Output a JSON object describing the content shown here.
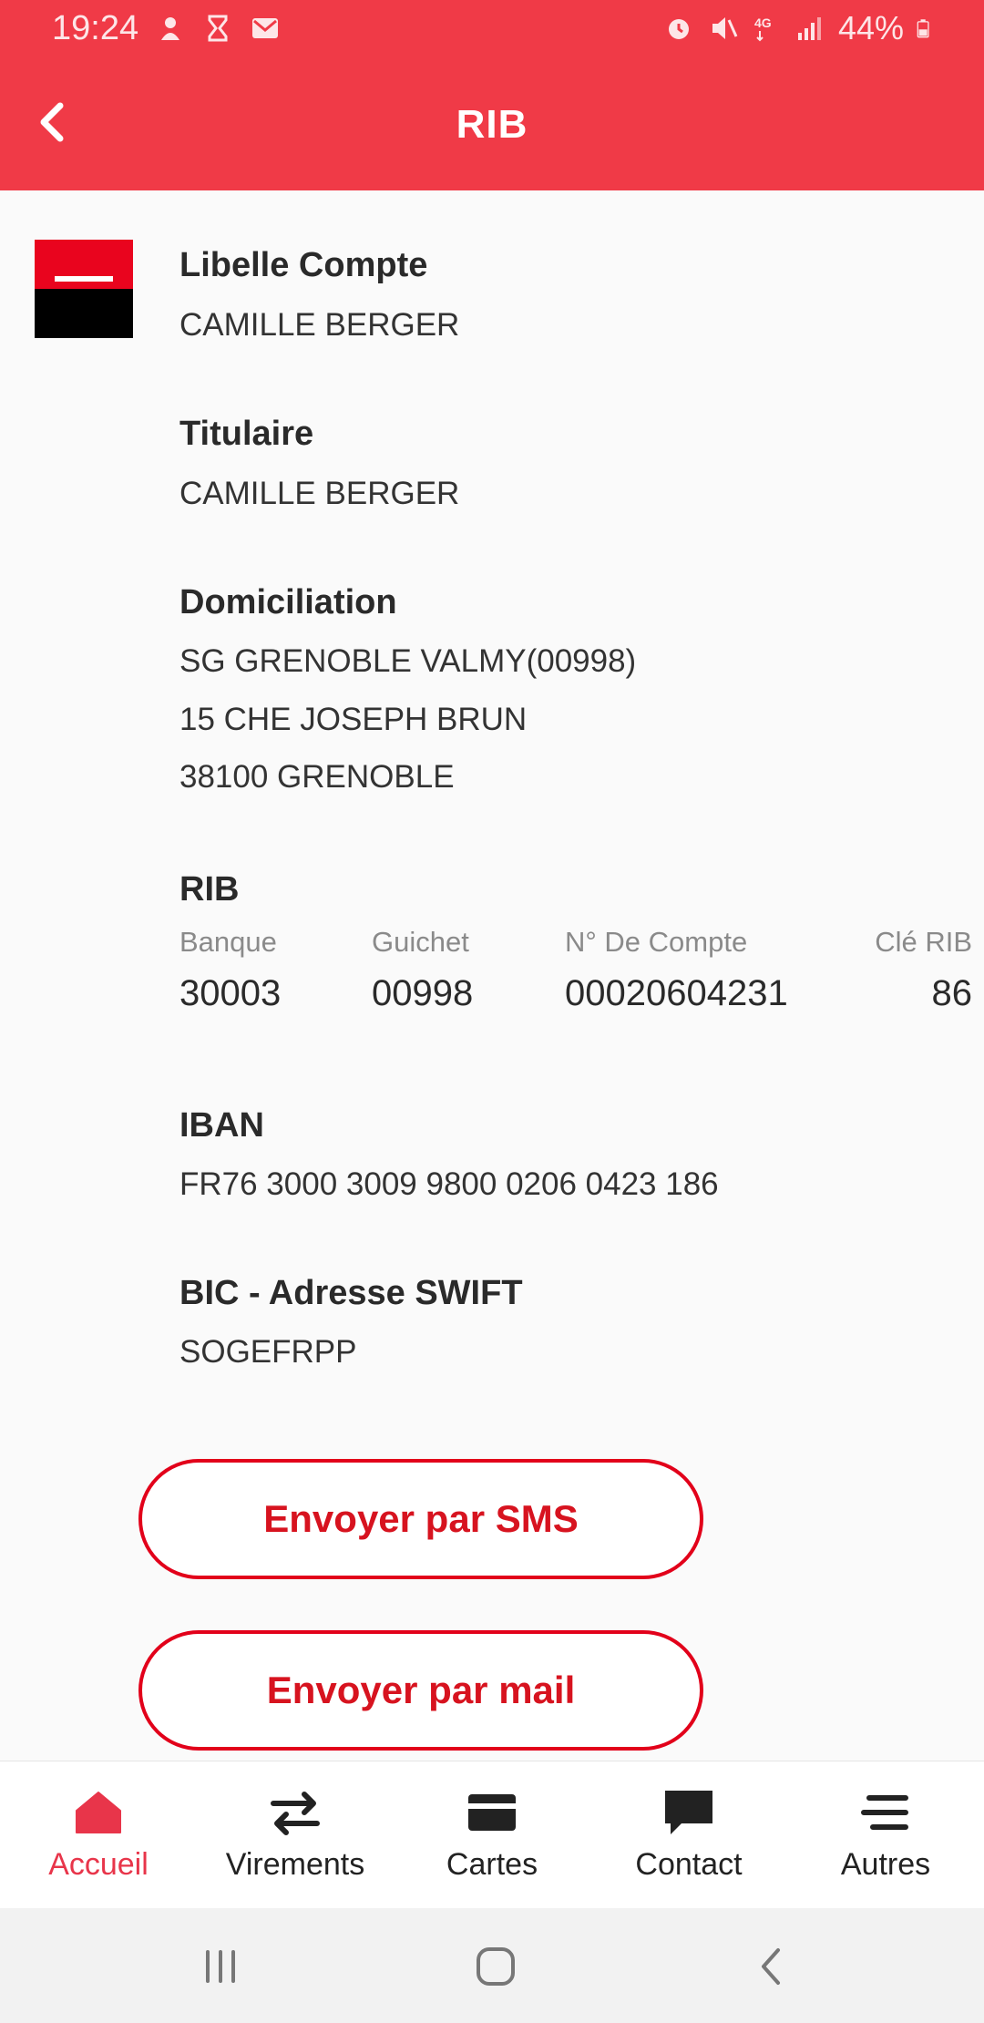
{
  "status": {
    "time": "19:24",
    "battery": "44%"
  },
  "header": {
    "title": "RIB"
  },
  "account": {
    "label_title": "Libelle Compte",
    "label_value": "CAMILLE BERGER",
    "holder_title": "Titulaire",
    "holder_value": "CAMILLE BERGER",
    "domiciliation_title": "Domiciliation",
    "domiciliation_lines": [
      "SG GRENOBLE VALMY(00998)",
      "15 CHE JOSEPH BRUN",
      "38100 GRENOBLE"
    ],
    "rib_title": "RIB",
    "rib": {
      "headers": [
        "Banque",
        "Guichet",
        "N° De Compte",
        "Clé RIB"
      ],
      "values": [
        "30003",
        "00998",
        "00020604231",
        "86"
      ]
    },
    "iban_title": "IBAN",
    "iban_value": "FR76 3000 3009 9800 0206 0423 186",
    "bic_title": "BIC - Adresse SWIFT",
    "bic_value": "SOGEFRPP"
  },
  "actions": {
    "sms": "Envoyer par SMS",
    "mail": "Envoyer par mail"
  },
  "nav": {
    "items": [
      {
        "label": "Accueil",
        "icon": "home-icon",
        "active": true
      },
      {
        "label": "Virements",
        "icon": "transfer-icon",
        "active": false
      },
      {
        "label": "Cartes",
        "icon": "card-icon",
        "active": false
      },
      {
        "label": "Contact",
        "icon": "chat-icon",
        "active": false
      },
      {
        "label": "Autres",
        "icon": "menu-icon",
        "active": false
      }
    ]
  },
  "colors": {
    "brand_red": "#f03a47",
    "button_red": "#e2001a",
    "active_nav": "#e8354a"
  }
}
